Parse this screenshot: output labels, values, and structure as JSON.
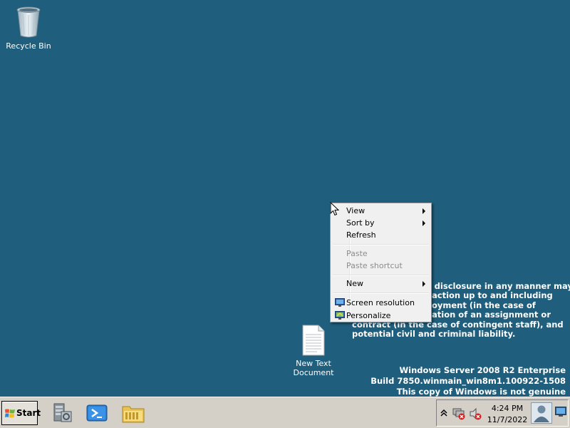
{
  "desktop": {
    "background": "#1f5e7c",
    "icons": [
      {
        "label": "Recycle Bin",
        "icon": "recycle-bin-icon"
      },
      {
        "label_line1": "New Text",
        "label_line2": "Document",
        "icon": "text-document-icon"
      }
    ],
    "notice": {
      "line1": "r disclosure in any manner may",
      "line2": "action up to and including",
      "line3": "oyment (in the case of",
      "line4": "ation of an assignment or",
      "line5": "contract (in the case of contingent staff), and",
      "line6": "potential civil and criminal liability."
    },
    "watermark": {
      "line1": "Windows Server 2008 R2 Enterprise",
      "line2": "Build 7850.winmain_win8m1.100922-1508",
      "line3": "This copy of Windows is not genuine"
    }
  },
  "context_menu": {
    "view": "View",
    "sort_by": "Sort by",
    "refresh": "Refresh",
    "paste": "Paste",
    "paste_shortcut": "Paste shortcut",
    "new": "New",
    "screen_resolution": "Screen resolution",
    "personalize": "Personalize"
  },
  "taskbar": {
    "start_label": "Start",
    "launchers": [
      "server-manager-icon",
      "powershell-icon",
      "explorer-folder-icon"
    ],
    "tray": {
      "icons": [
        "show-hidden-icons-arrow",
        "network-error-icon",
        "volume-muted-icon",
        "user-avatar-icon",
        "show-desktop-icon"
      ],
      "time": "4:24 PM",
      "date": "11/7/2022"
    }
  },
  "colors": {
    "desktop": "#1f5e7c",
    "menu_bg": "#f0f0f0",
    "taskbar": "#d4d0c8",
    "watermark_text": "#ffffff"
  }
}
